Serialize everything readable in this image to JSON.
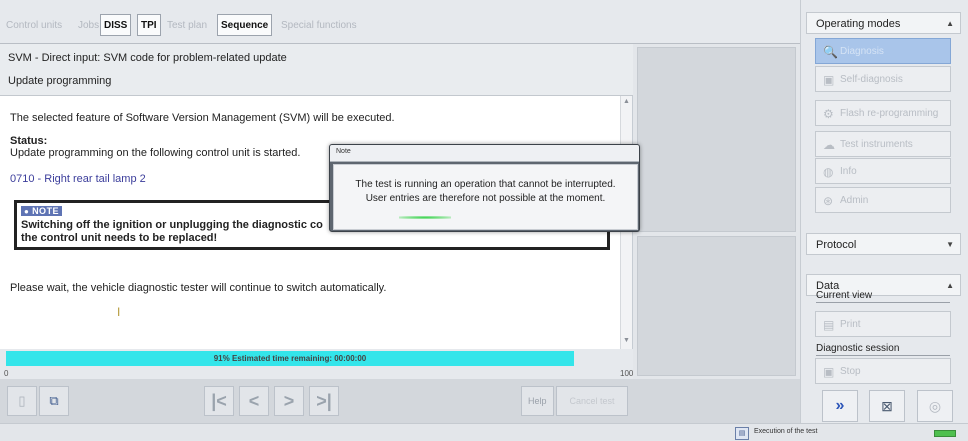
{
  "tabs": [
    {
      "label": "Control units",
      "state": "disabled"
    },
    {
      "label": "Jobs",
      "state": "disabled"
    },
    {
      "label": "DISS",
      "state": "active"
    },
    {
      "label": "TPI",
      "state": "active"
    },
    {
      "label": "Test plan",
      "state": "disabled"
    },
    {
      "label": "Sequence",
      "state": "active"
    },
    {
      "label": "Special functions",
      "state": "disabled"
    }
  ],
  "header": {
    "title": "SVM - Direct input: SVM code for problem-related update",
    "subtitle": "Update programming"
  },
  "content": {
    "intro": "The selected feature of Software Version Management (SVM) will be executed.",
    "status_label": "Status:",
    "status_text": "Update programming on the following control unit is started.",
    "control_unit": "0710 - Right rear tail lamp 2",
    "note_badge": "NOTE",
    "note_line1": "Switching off the ignition or unplugging the diagnostic co",
    "note_line2": "the control unit needs to be replaced!",
    "wait_text": "Please wait, the vehicle diagnostic tester will continue to switch automatically.",
    "cursor_glyph": "I"
  },
  "progress": {
    "percent": 91,
    "label": "91% Estimated time remaining: 00:00:00",
    "min": "0",
    "max": "100"
  },
  "dialog": {
    "title": "Note",
    "line1": "The test is running an operation that cannot be interrupted.",
    "line2": "User entries are therefore not possible at the moment."
  },
  "toolbar": {
    "help": "Help",
    "cancel": "Cancel test",
    "nav_first": "|<",
    "nav_prev": "<",
    "nav_next": ">",
    "nav_last": ">|"
  },
  "right": {
    "operating_modes": "Operating modes",
    "modes": [
      {
        "label": "Diagnosis",
        "icon": "diagnosis-icon",
        "selected": true
      },
      {
        "label": "Self-diagnosis",
        "icon": "self-diagnosis-icon",
        "selected": false
      },
      {
        "label": "Flash re-programming",
        "icon": "flash-icon",
        "selected": false
      },
      {
        "label": "Test instruments",
        "icon": "instruments-icon",
        "selected": false
      },
      {
        "label": "Info",
        "icon": "info-icon",
        "selected": false
      },
      {
        "label": "Admin",
        "icon": "admin-icon",
        "selected": false
      }
    ],
    "protocol": "Protocol",
    "data": "Data",
    "current_view": "Current view",
    "print": "Print",
    "diagnostic_session": "Diagnostic session",
    "stop": "Stop"
  },
  "status_bar": {
    "text": "Execution of the test"
  },
  "colors": {
    "progress": "#34e5ea",
    "selected_mode": "#a9c5ea",
    "note_badge": "#5f74b4",
    "link_blue": "#3b3d9b"
  }
}
